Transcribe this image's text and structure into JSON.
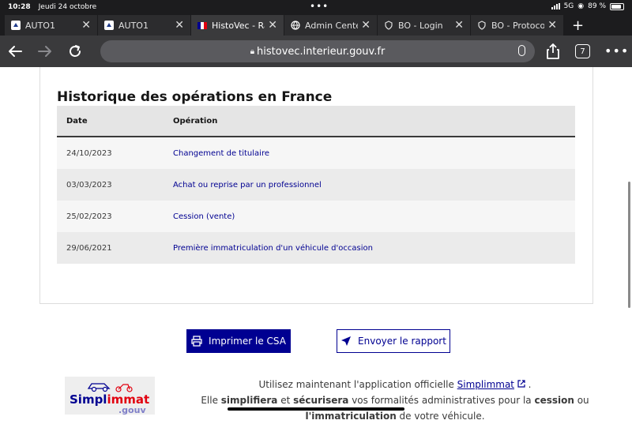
{
  "status": {
    "time": "10:28",
    "date": "Jeudi 24 octobre",
    "network": "5G",
    "battery": "89 %"
  },
  "tabs": [
    {
      "label": "AUTO1",
      "icon": "auto1-logo-icon",
      "active": false
    },
    {
      "label": "AUTO1",
      "icon": "auto1-logo-icon",
      "active": false
    },
    {
      "label": "HistoVec - Rapp",
      "icon": "french-flag-icon",
      "active": true
    },
    {
      "label": "Admin Center",
      "icon": "globe-icon",
      "active": false
    },
    {
      "label": "BO - Login",
      "icon": "shield-icon",
      "active": false
    },
    {
      "label": "BO - Protocole Enter",
      "icon": "shield-icon",
      "active": false
    }
  ],
  "browser": {
    "url": "histovec.interieur.gouv.fr",
    "tab_count": "7"
  },
  "history": {
    "title": "Historique des opérations en France",
    "headers": {
      "date": "Date",
      "operation": "Opération"
    },
    "rows": [
      {
        "date": "24/10/2023",
        "operation": "Changement de titulaire"
      },
      {
        "date": "03/03/2023",
        "operation": "Achat ou reprise par un professionnel"
      },
      {
        "date": "25/02/2023",
        "operation": "Cession (vente)"
      },
      {
        "date": "29/06/2021",
        "operation": "Première immatriculation d'un véhicule d'occasion"
      }
    ]
  },
  "actions": {
    "print_label": "Imprimer le CSA",
    "send_label": "Envoyer le rapport"
  },
  "promo": {
    "logo_text_1": "Simpl",
    "logo_text_2": "immat",
    "logo_suffix": ".gouv",
    "line1_prefix": "Utilisez maintenant l'application officielle ",
    "link": "Simplimmat",
    "line1_suffix": ".",
    "line2_prefix": "Elle ",
    "bold1": "simplifiera",
    "line2_mid": " et ",
    "bold2": "sécurisera",
    "line2_mid2": " vos formalités administratives pour la ",
    "bold3": "cession",
    "line2_end": " ou",
    "bold4": "l'immatriculation",
    "line3_end": " de votre véhicule."
  }
}
